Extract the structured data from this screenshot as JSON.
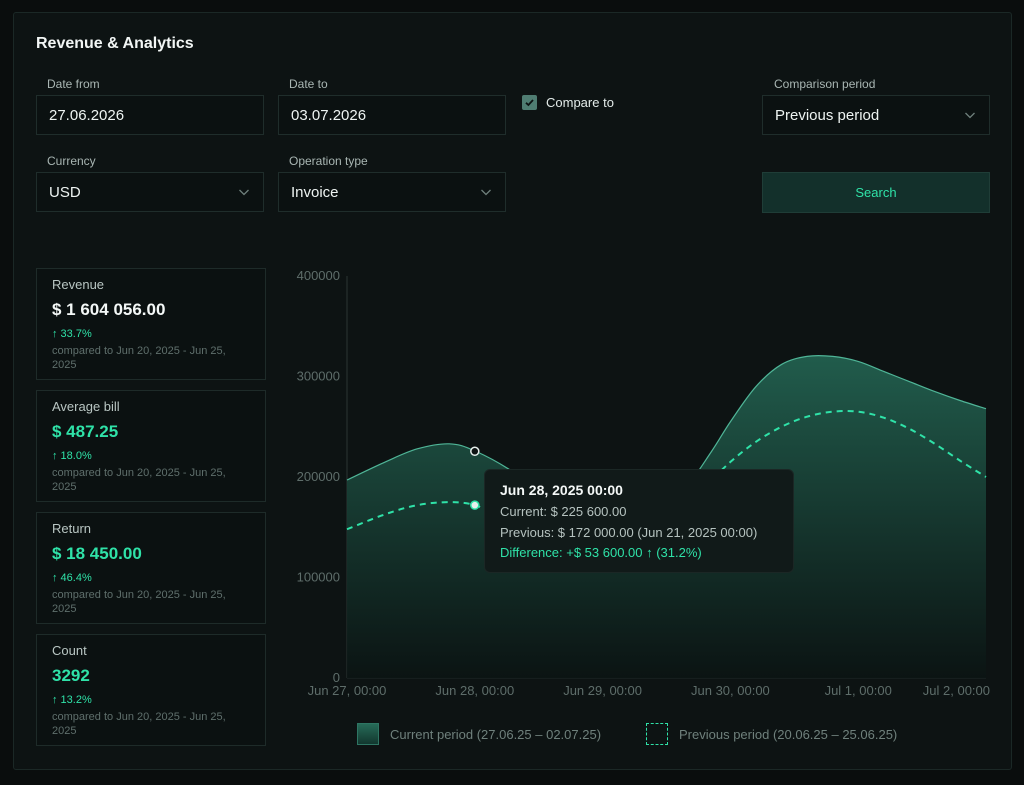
{
  "header": {
    "title": "Revenue & Analytics"
  },
  "filters": {
    "date_from": {
      "label": "Date from",
      "value": "27.06.2026"
    },
    "date_to": {
      "label": "Date to",
      "value": "03.07.2026"
    },
    "compare_to": {
      "label": "Compare to",
      "checked": true
    },
    "comparison_period": {
      "label": "Comparison period",
      "value": "Previous period"
    },
    "currency": {
      "label": "Currency",
      "value": "USD"
    },
    "operation_type": {
      "label": "Operation type",
      "value": "Invoice"
    },
    "search_label": "Search"
  },
  "stats": [
    {
      "label": "Revenue",
      "value": "$ 1 604 056.00",
      "change": "↑ 33.7%",
      "compare": "compared to Jun 20, 2025 - Jun 25, 2025"
    },
    {
      "label": "Average bill",
      "value": "$ 487.25",
      "change": "↑ 18.0%",
      "compare": "compared to Jun 20, 2025 - Jun 25, 2025"
    },
    {
      "label": "Return",
      "value": "$ 18 450.00",
      "change": "↑ 46.4%",
      "compare": "compared to Jun 20, 2025 - Jun 25, 2025"
    },
    {
      "label": "Count",
      "value": "3292",
      "change": "↑ 13.2%",
      "compare": "compared to Jun 20, 2025 - Jun 25, 2025"
    }
  ],
  "tooltip": {
    "title": "Jun 28, 2025 00:00",
    "current": "Current: $ 225 600.00",
    "previous": "Previous: $ 172 000.00 (Jun 21, 2025 00:00)",
    "difference": "Difference: +$ 53 600.00 ↑ (31.2%)"
  },
  "legend": {
    "current": "Current period (27.06.25 – 02.07.25)",
    "previous": "Previous period (20.06.25 – 25.06.25)"
  },
  "colors": {
    "accent": "#2fe2a8",
    "current_fill": "#1f5a4b",
    "current_line": "#4fb597",
    "previous_line": "#2fe2a8"
  },
  "chart_data": {
    "type": "area",
    "x": [
      "Jun 27, 00:00",
      "Jun 28, 00:00",
      "Jun 29, 00:00",
      "Jun 30, 00:00",
      "Jul 1, 00:00",
      "Jul 2, 00:00"
    ],
    "y_ticks": [
      0,
      100000,
      200000,
      300000,
      400000
    ],
    "ylim": [
      0,
      400000
    ],
    "series": [
      {
        "name": "Current period (27.06.25 – 02.07.25)",
        "style": "area",
        "x": [
          0,
          0.3,
          0.55,
          0.8,
          1.0,
          1.3,
          1.6,
          1.8,
          2.0,
          2.2,
          2.4,
          2.6,
          2.85,
          3.0,
          3.2,
          3.4,
          3.6,
          3.8,
          4.0,
          4.2,
          4.4,
          4.6,
          4.8,
          5.0
        ],
        "values": [
          197000,
          215000,
          228000,
          233000,
          226000,
          205000,
          175000,
          155000,
          148000,
          150000,
          160000,
          180000,
          225000,
          255000,
          290000,
          312000,
          320000,
          320000,
          315000,
          305000,
          295000,
          285000,
          276000,
          268000
        ]
      },
      {
        "name": "Previous period (20.06.25 – 25.06.25)",
        "style": "dashed-line",
        "x": [
          0,
          0.3,
          0.55,
          0.8,
          1.0,
          1.2,
          1.5,
          1.8,
          2.0,
          2.2,
          2.4,
          2.6,
          2.8,
          3.0,
          3.2,
          3.4,
          3.6,
          3.8,
          4.0,
          4.2,
          4.4,
          4.6,
          4.8,
          5.0
        ],
        "values": [
          148000,
          163000,
          172000,
          175000,
          172000,
          160000,
          140000,
          128000,
          125000,
          130000,
          145000,
          165000,
          190000,
          215000,
          235000,
          250000,
          260000,
          265000,
          265000,
          259000,
          248000,
          233000,
          216000,
          200000
        ]
      }
    ],
    "highlight": {
      "x": 1.0,
      "current": 225600,
      "previous": 172000
    },
    "xlabel": "",
    "ylabel": "",
    "grid": false
  }
}
